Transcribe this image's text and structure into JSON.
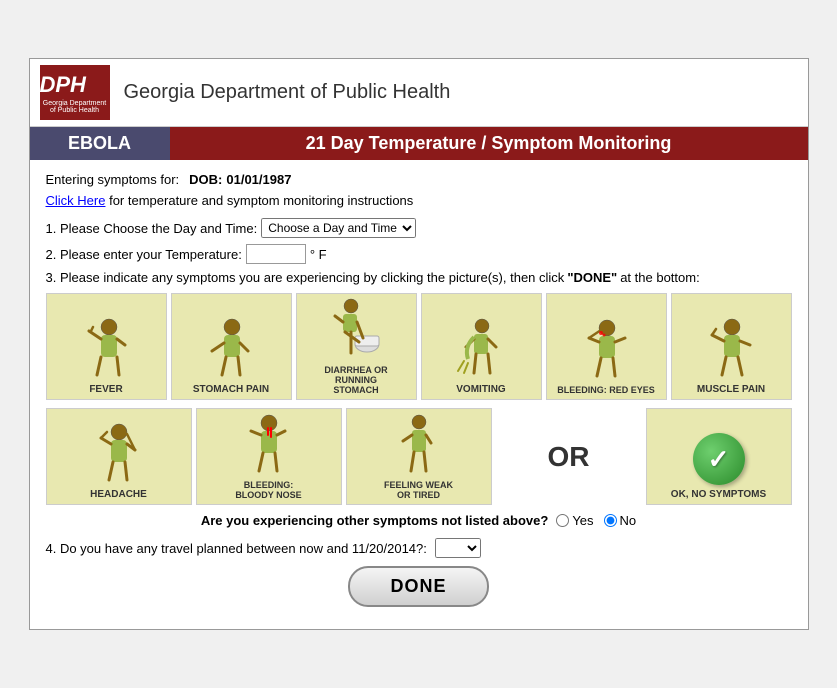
{
  "header": {
    "logo_text": "DPH",
    "logo_sub": "Georgia Department of Public Health",
    "org_name": "Georgia Department of Public Health",
    "banner_left": "EBOLA",
    "banner_right": "21 Day Temperature / Symptom Monitoring"
  },
  "form": {
    "entering_label": "Entering symptoms for:",
    "dob_label": "DOB:",
    "dob_value": "01/01/1987",
    "click_here_text": "Click Here",
    "instructions_text": "for temperature and symptom monitoring instructions",
    "step1_label": "1. Please Choose the Day and Time:",
    "day_time_placeholder": "Choose a Day and Time",
    "step2_label": "2. Please enter your Temperature:",
    "temp_unit": "° F",
    "step3_label": "3. Please indicate any symptoms you are experiencing by clicking the picture(s), then click",
    "step3_done": "\"DONE\"",
    "step3_end": "at the bottom:",
    "other_symptoms_label": "Are you experiencing other symptoms not listed above?",
    "yes_label": "Yes",
    "no_label": "No",
    "travel_label": "4. Do you have any travel planned between now and 11/20/2014?:",
    "done_label": "DONE"
  },
  "symptoms": [
    {
      "id": "fever",
      "label": "FEVER"
    },
    {
      "id": "stomach-pain",
      "label": "STOMACH PAIN"
    },
    {
      "id": "diarrhea",
      "label": "DIARRHEA OR RUNNING STOMACH"
    },
    {
      "id": "vomiting",
      "label": "VOMITING"
    },
    {
      "id": "bleeding-eyes",
      "label": "BLEEDING: RED EYES"
    },
    {
      "id": "muscle-pain",
      "label": "MUSCLE PAIN"
    },
    {
      "id": "headache",
      "label": "HEADACHE"
    },
    {
      "id": "bleeding-nose",
      "label": "BLEEDING: BLOODY NOSE"
    },
    {
      "id": "feeling-weak",
      "label": "FEELING WEAK OR TIRED"
    },
    {
      "id": "ok-no-symptoms",
      "label": "OK, NO SYMPTOMS"
    }
  ],
  "colors": {
    "banner_left_bg": "#4a4a6e",
    "banner_right_bg": "#8b1a1a",
    "symptom_bg": "#e8e8b0",
    "logo_bg": "#8b1a1a"
  }
}
